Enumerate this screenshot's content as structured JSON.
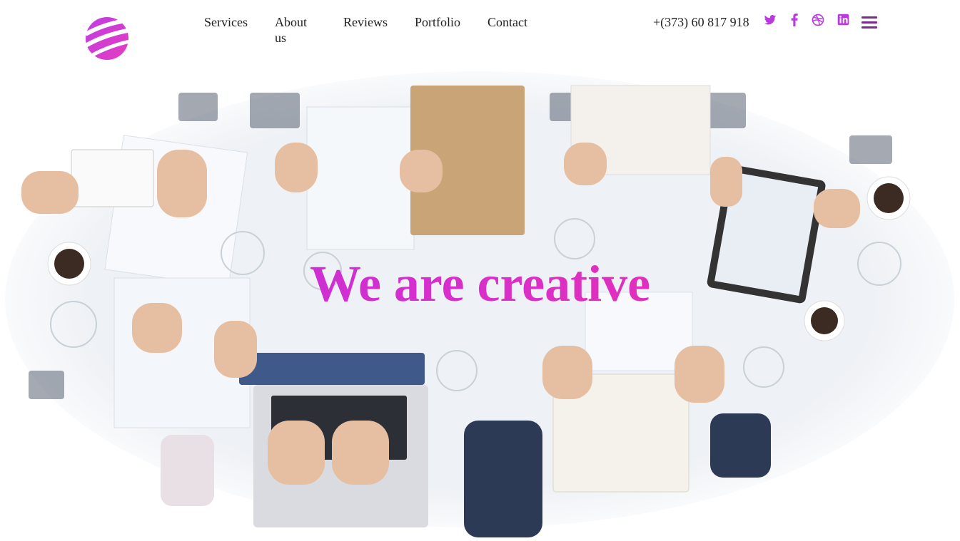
{
  "nav": {
    "items": [
      {
        "label": "Services"
      },
      {
        "label": "About us"
      },
      {
        "label": "Reviews"
      },
      {
        "label": "Portfolio"
      },
      {
        "label": "Contact"
      }
    ]
  },
  "contact": {
    "phone": "+(373) 60 817 918"
  },
  "social": [
    "twitter-icon",
    "facebook-icon",
    "dribbble-icon",
    "linkedin-icon"
  ],
  "hero": {
    "title": "We are creative"
  },
  "colors": {
    "accent": "#b62ee0",
    "accent_end": "#f02fa6",
    "menu": "#7b2a9b"
  }
}
